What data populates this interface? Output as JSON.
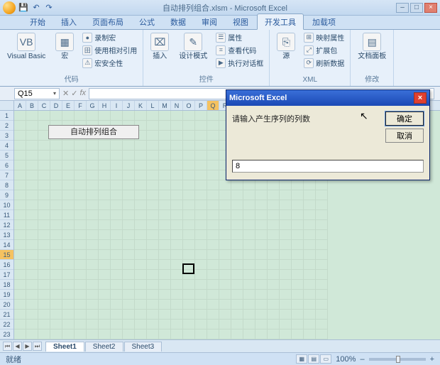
{
  "title": "自动排列组合.xlsm - Microsoft Excel",
  "qat": {
    "save": "💾",
    "undo": "↶",
    "redo": "↷"
  },
  "wincontrols": {
    "min": "–",
    "max": "□",
    "close": "×"
  },
  "tabs": [
    "开始",
    "插入",
    "页面布局",
    "公式",
    "数据",
    "审阅",
    "视图",
    "开发工具",
    "加载项"
  ],
  "active_tab_index": 7,
  "ribbon": {
    "groups": [
      {
        "label": "代码",
        "big": [
          {
            "name": "visual-basic",
            "icon": "VB",
            "label": "Visual Basic"
          },
          {
            "name": "macros",
            "icon": "▦",
            "label": "宏"
          }
        ],
        "small": [
          {
            "name": "record-macro",
            "icon": "●",
            "label": "录制宏"
          },
          {
            "name": "use-relative",
            "icon": "田",
            "label": "使用相对引用"
          },
          {
            "name": "macro-security",
            "icon": "⚠",
            "label": "宏安全性"
          }
        ]
      },
      {
        "label": "控件",
        "big": [
          {
            "name": "insert-ctrl",
            "icon": "⌧",
            "label": "插入"
          },
          {
            "name": "design-mode",
            "icon": "✎",
            "label": "设计模式"
          }
        ],
        "small": [
          {
            "name": "properties",
            "icon": "☰",
            "label": "属性"
          },
          {
            "name": "view-code",
            "icon": "⌗",
            "label": "查看代码"
          },
          {
            "name": "run-dialog",
            "icon": "▶",
            "label": "执行对话框"
          }
        ]
      },
      {
        "label": "XML",
        "big": [
          {
            "name": "source",
            "icon": "⎘",
            "label": "源"
          }
        ],
        "small": [
          {
            "name": "map-props",
            "icon": "⊞",
            "label": "映射属性"
          },
          {
            "name": "expansion",
            "icon": "⤢",
            "label": "扩展包"
          },
          {
            "name": "refresh",
            "icon": "⟳",
            "label": "刷新数据"
          }
        ]
      },
      {
        "label": "修改",
        "big": [
          {
            "name": "doc-panel",
            "icon": "▤",
            "label": "文档面板"
          }
        ],
        "small": []
      }
    ]
  },
  "formula_bar": {
    "name_box": "Q15",
    "fx": "fx",
    "formula": ""
  },
  "columns": [
    "A",
    "B",
    "C",
    "D",
    "E",
    "F",
    "G",
    "H",
    "I",
    "J",
    "K",
    "L",
    "M",
    "N",
    "O",
    "P",
    "Q",
    "R",
    "S",
    "T",
    "U",
    "V",
    "W",
    "X",
    "Y",
    "Z"
  ],
  "selected_col_index": 16,
  "rows": 23,
  "selected_row": 15,
  "form_button": "自动排列组合",
  "dialog": {
    "title": "Microsoft Excel",
    "prompt": "请输入产生序列的列数",
    "input_value": "8",
    "ok": "确定",
    "cancel": "取消"
  },
  "sheets": [
    "Sheet1",
    "Sheet2",
    "Sheet3"
  ],
  "active_sheet_index": 0,
  "sheet_nav": {
    "first": "⏮",
    "prev": "◀",
    "next": "▶",
    "last": "⏭"
  },
  "status": {
    "ready": "就绪",
    "zoom": "100%",
    "minus": "–",
    "plus": "+"
  }
}
